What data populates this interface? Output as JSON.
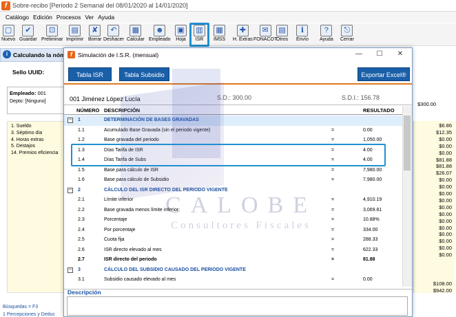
{
  "app": {
    "title": "Sobre-recibo [Periodo 2 Semanal del 08/01/2020 al 14/01/2020]"
  },
  "menu": [
    "Catálogo",
    "Edición",
    "Procesos",
    "Ver",
    "Ayuda"
  ],
  "toolbar": {
    "items": [
      {
        "label": "Nuevo",
        "icon": "new-icon"
      },
      {
        "label": "Guardar",
        "icon": "save-icon"
      },
      {
        "label": "Preliminar",
        "icon": "preview-icon"
      },
      {
        "label": "Imprimir",
        "icon": "print-icon"
      },
      {
        "label": "Borrar",
        "icon": "delete-icon"
      },
      {
        "label": "Deshacer",
        "icon": "undo-icon"
      },
      {
        "label": "Calcular",
        "icon": "calc-icon"
      },
      {
        "label": "Empleado",
        "icon": "employee-icon"
      },
      {
        "label": "Hoja",
        "icon": "sheet-icon"
      },
      {
        "label": "ISR",
        "icon": "isr-icon"
      },
      {
        "label": "IMSS",
        "icon": "imss-icon"
      },
      {
        "label": "H. Extras",
        "icon": "overtime-icon"
      },
      {
        "label": "FONACOT",
        "icon": "fonacot-icon"
      },
      {
        "label": "Otros",
        "icon": "others-icon"
      },
      {
        "label": "Envío",
        "icon": "send-icon"
      },
      {
        "label": "Ayuda",
        "icon": "help-icon"
      },
      {
        "label": "Cerrar",
        "icon": "close-icon"
      }
    ]
  },
  "background": {
    "calculating": "Calculando la nómi",
    "sello": "Sello UUID:",
    "empleado_label": "Empleado:",
    "empleado_value": "001",
    "depto": "Depto: [Ninguno]",
    "concepts": [
      "1. Sueldo",
      "3. Séptimo día",
      "4. Horas extras",
      "5. Destajos",
      "14. Premios eficiencia"
    ],
    "right_header": "$300.00",
    "right_values": [
      "$6.86",
      "$12.35",
      "$0.00",
      "$0.00",
      "$0.00",
      "$81.88",
      "$81.88",
      "$26.07",
      "$0.00",
      "$0.00",
      "$0.00",
      "$0.00",
      "$0.00",
      "$0.00",
      "$0.00",
      "$0.00",
      "$0.00",
      "$0.00",
      "$0.00",
      "$0.00"
    ],
    "right_bottom": [
      "$108.00",
      "$942.00"
    ],
    "busquedas": "Búsquedas = F3",
    "bottom_cut": "1 Percepciones y Deduc"
  },
  "dialog": {
    "title": "Simulación de I.S.R. (mensual)",
    "buttons": {
      "tabla_isr": "Tabla ISR",
      "tabla_subsidio": "Tabla Subsidio",
      "exportar": "Exportar Excel®"
    },
    "employee": "001  Jiménez López Lucía",
    "sd_label": "S.D.: 300.00",
    "sdi_label": "S.D.I.: 156.78",
    "columns": {
      "numero": "NÚMERO",
      "descripcion": "DESCRIPCIÓN",
      "resultado": "RESULTADO"
    },
    "rows": [
      {
        "num": "1",
        "desc": "DETERMINACIÓN DE BASES GRAVADAS",
        "eq": "",
        "res": "",
        "type": "sec"
      },
      {
        "num": "1.1",
        "desc": "Acumulado Base Gravada (sin el periodo vigente)",
        "eq": "=",
        "res": "0.00",
        "type": ""
      },
      {
        "num": "1.2",
        "desc": "Base gravada del periodo",
        "eq": "=",
        "res": "1,050.00",
        "type": ""
      },
      {
        "num": "1.3",
        "desc": "Días Tarifa de ISR",
        "eq": "=",
        "res": "4.00",
        "type": ""
      },
      {
        "num": "1.4",
        "desc": "Días Tarifa de Subs",
        "eq": "=",
        "res": "4.00",
        "type": ""
      },
      {
        "num": "1.5",
        "desc": "Base para cálculo de ISR",
        "eq": "=",
        "res": "7,980.00",
        "type": ""
      },
      {
        "num": "1.6",
        "desc": "Base para cálculo de Subsidio",
        "eq": "=",
        "res": "7,980.00",
        "type": ""
      },
      {
        "num": "2",
        "desc": "CÁLCULO DEL ISR DIRECTO DEL PERIODO VIGENTE",
        "eq": "",
        "res": "",
        "type": "sec"
      },
      {
        "num": "2.1",
        "desc": "Límite inferior",
        "eq": "=",
        "res": "4,910.19",
        "type": ""
      },
      {
        "num": "2.2",
        "desc": "Base gravada menos límite inferior",
        "eq": "=",
        "res": "3,069.81",
        "type": ""
      },
      {
        "num": "2.3",
        "desc": "Porcentaje",
        "eq": "=",
        "res": "10.88%",
        "type": ""
      },
      {
        "num": "2.4",
        "desc": "Por porcentaje",
        "eq": "=",
        "res": "334.00",
        "type": ""
      },
      {
        "num": "2.5",
        "desc": "Cuota fija",
        "eq": "=",
        "res": "288.33",
        "type": ""
      },
      {
        "num": "2.6",
        "desc": "ISR directo elevado al mes",
        "eq": "=",
        "res": "622.33",
        "type": ""
      },
      {
        "num": "2.7",
        "desc": "ISR directo del periodo",
        "eq": "=",
        "res": "81.88",
        "type": "bold"
      },
      {
        "num": "3",
        "desc": "CÁLCULO DEL SUBSIDIO CAUSADO DEL PERIODO VIGENTE",
        "eq": "",
        "res": "",
        "type": "sec"
      },
      {
        "num": "3.1",
        "desc": "Subsidio causado elevado al mes",
        "eq": "=",
        "res": "0.00",
        "type": ""
      }
    ],
    "descripcion_label": "Descripción"
  },
  "watermark": {
    "main": "CALOBE",
    "sub": "Consultores Fiscales"
  }
}
